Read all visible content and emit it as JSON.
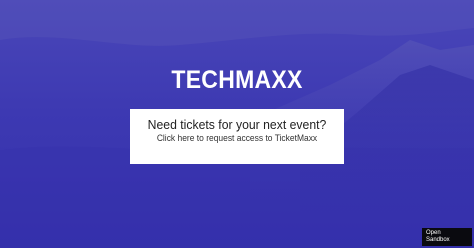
{
  "brand": {
    "title": "TECHMAXX"
  },
  "card": {
    "title": "Need tickets for your next event?",
    "subtitle": "Click here to request access to TicketMaxx"
  },
  "sandbox_button": {
    "line1": "Open",
    "line2": "Sandbox"
  },
  "colors": {
    "background": "#3a36b0",
    "card": "#ffffff",
    "button": "#0a0a0f"
  }
}
